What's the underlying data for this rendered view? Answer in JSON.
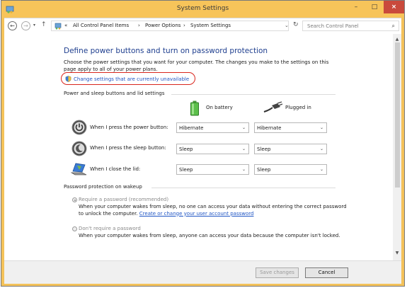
{
  "window": {
    "title": "System Settings",
    "minimize": "–",
    "maximize": "□",
    "close": "×"
  },
  "nav": {
    "back": "←",
    "forward": "→",
    "history": "▾",
    "up": "↑",
    "breadcrumb": [
      "«",
      "All Control Panel Items",
      "›",
      "Power Options",
      "›",
      "System Settings"
    ],
    "address_dropdown": "⌄",
    "refresh": "↻",
    "search_placeholder": "Search Control Panel"
  },
  "page": {
    "heading": "Define power buttons and turn on password protection",
    "description": "Choose the power settings that you want for your computer. The changes you make to the settings on this page apply to all of your power plans.",
    "change_link": "Change settings that are currently unavailable"
  },
  "power_section": {
    "title": "Power and sleep buttons and lid settings",
    "on_battery": "On battery",
    "plugged_in": "Plugged in",
    "rows": [
      {
        "label": "When I press the power button:",
        "battery": "Hibernate",
        "plugged": "Hibernate"
      },
      {
        "label": "When I press the sleep button:",
        "battery": "Sleep",
        "plugged": "Sleep"
      },
      {
        "label": "When I close the lid:",
        "battery": "Sleep",
        "plugged": "Sleep"
      }
    ]
  },
  "password_section": {
    "title": "Password protection on wakeup",
    "require_label": "Require a password (recommended)",
    "require_desc": "When your computer wakes from sleep, no one can access your data without entering the correct password to unlock the computer.",
    "require_link": "Create or change your user account password",
    "norequire_label": "Don't require a password",
    "norequire_desc": "When your computer wakes from sleep, anyone can access your data because the computer isn't locked."
  },
  "footer": {
    "save": "Save changes",
    "cancel": "Cancel"
  },
  "colors": {
    "titlebar": "#f7c45a",
    "close_button": "#c94a3c",
    "heading": "#1f3f8f",
    "link": "#1f55c4",
    "highlight_oval": "#d9261d"
  }
}
